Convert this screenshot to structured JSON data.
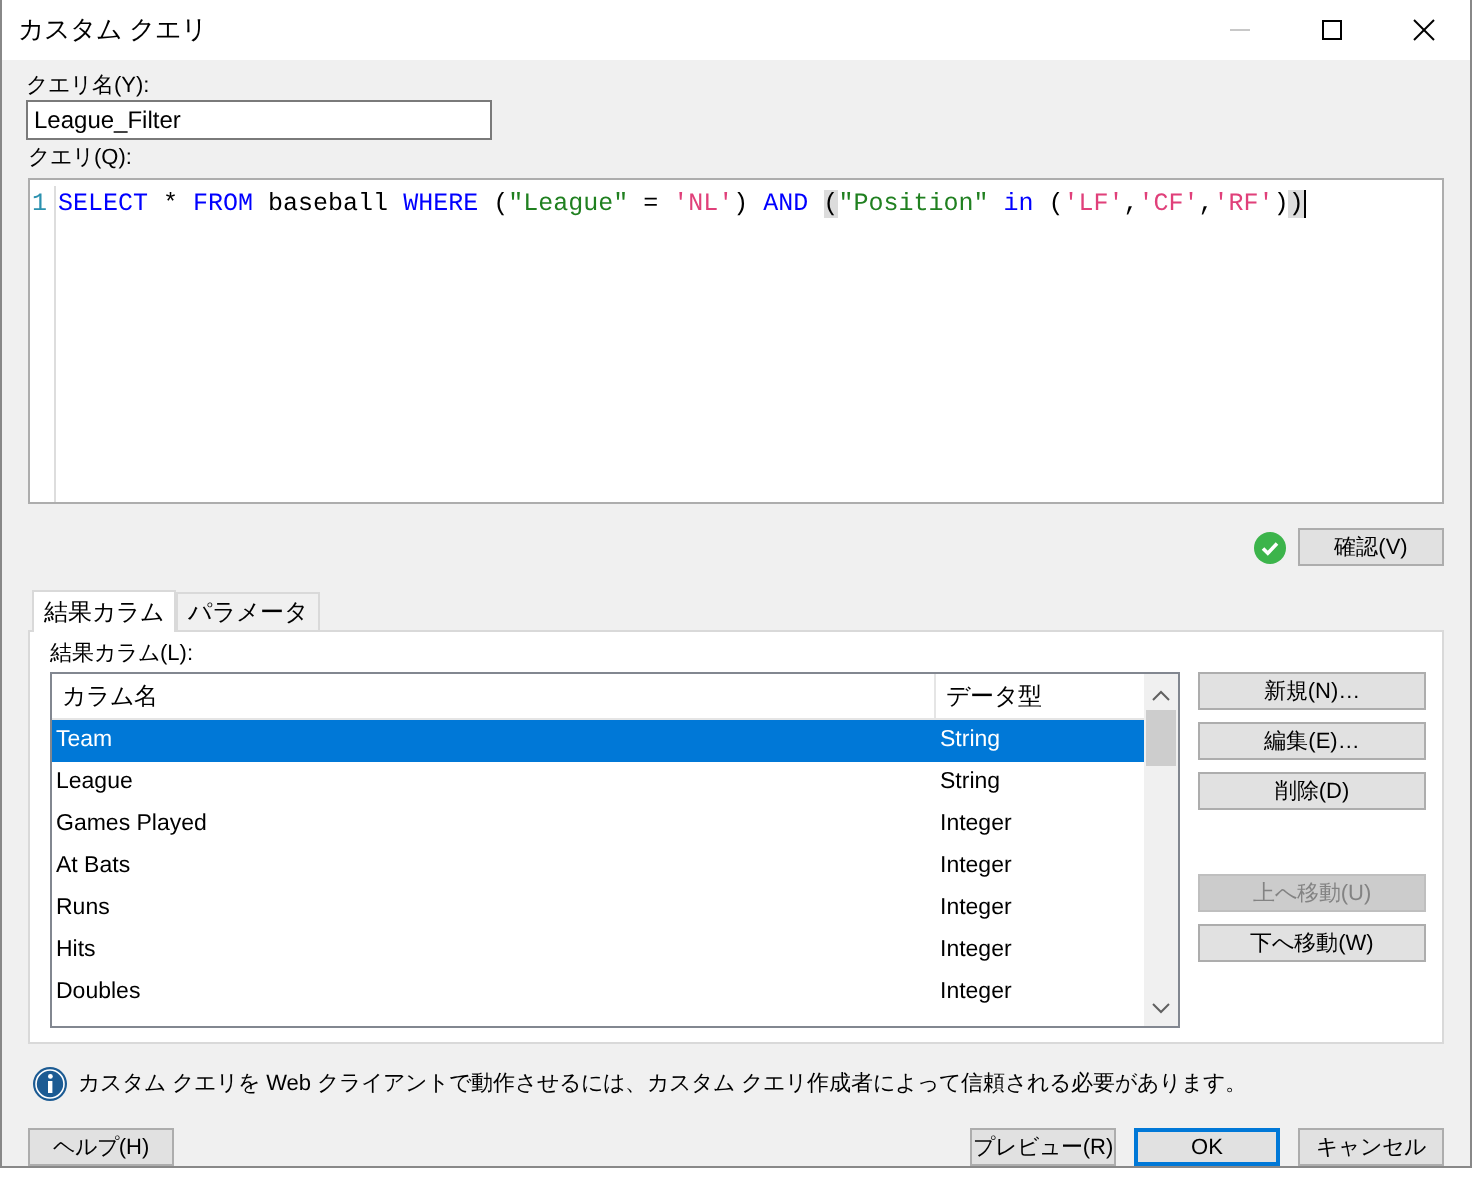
{
  "window": {
    "title": "カスタム クエリ",
    "controls": [
      {
        "kind": "minimize",
        "disabled": true
      },
      {
        "kind": "maximize",
        "disabled": false
      },
      {
        "kind": "close",
        "disabled": false
      }
    ]
  },
  "query_name": {
    "label": "クエリ名(Y):",
    "value": "League_Filter"
  },
  "query": {
    "label": "クエリ(Q):",
    "line_number": "1",
    "tokens": [
      {
        "text": "SELECT",
        "kind": "keyword"
      },
      {
        "text": " * ",
        "kind": "plain"
      },
      {
        "text": "FROM",
        "kind": "keyword"
      },
      {
        "text": " baseball ",
        "kind": "plain"
      },
      {
        "text": "WHERE",
        "kind": "keyword"
      },
      {
        "text": " (",
        "kind": "plain"
      },
      {
        "text": "\"League\"",
        "kind": "identifier"
      },
      {
        "text": " = ",
        "kind": "plain"
      },
      {
        "text": "'NL'",
        "kind": "literal"
      },
      {
        "text": ") ",
        "kind": "plain"
      },
      {
        "text": "AND ",
        "kind": "keyword"
      },
      {
        "text": "(",
        "kind": "match"
      },
      {
        "text": "\"Position\" ",
        "kind": "identifier"
      },
      {
        "text": "in",
        "kind": "keyword"
      },
      {
        "text": " (",
        "kind": "plain"
      },
      {
        "text": "'LF'",
        "kind": "literal"
      },
      {
        "text": ",",
        "kind": "plain"
      },
      {
        "text": "'CF'",
        "kind": "literal"
      },
      {
        "text": ",",
        "kind": "plain"
      },
      {
        "text": "'RF'",
        "kind": "literal"
      },
      {
        "text": ")",
        "kind": "plain"
      },
      {
        "text": ")",
        "kind": "match"
      }
    ]
  },
  "validation": {
    "valid": true,
    "button": "確認(V)"
  },
  "tabs": [
    {
      "label": "結果カラム",
      "selected": true
    },
    {
      "label": "パラメータ",
      "selected": false
    }
  ],
  "result_columns": {
    "label": "結果カラム(L):",
    "columns": [
      "カラム名",
      "データ型"
    ],
    "rows": [
      {
        "name": "Team",
        "type": "String",
        "selected": true
      },
      {
        "name": "League",
        "type": "String",
        "selected": false
      },
      {
        "name": "Games Played",
        "type": "Integer",
        "selected": false
      },
      {
        "name": "At Bats",
        "type": "Integer",
        "selected": false
      },
      {
        "name": "Runs",
        "type": "Integer",
        "selected": false
      },
      {
        "name": "Hits",
        "type": "Integer",
        "selected": false
      },
      {
        "name": "Doubles",
        "type": "Integer",
        "selected": false
      }
    ]
  },
  "side_button_groups": [
    {
      "buttons": [
        {
          "label": "新規(N)…",
          "disabled": false
        },
        {
          "label": "編集(E)…",
          "disabled": false
        },
        {
          "label": "削除(D)",
          "disabled": false
        }
      ]
    },
    {
      "buttons": [
        {
          "label": "上へ移動(U)",
          "disabled": true
        },
        {
          "label": "下へ移動(W)",
          "disabled": false
        }
      ]
    }
  ],
  "info": "カスタム クエリを Web クライアントで動作させるには、カスタム クエリ作成者によって信頼される必要があります。",
  "help_button": "ヘルプ(H)",
  "buttons": [
    {
      "label": "プレビュー(R)",
      "default": false
    },
    {
      "label": "OK",
      "default": true
    },
    {
      "label": "キャンセル",
      "default": false
    }
  ]
}
